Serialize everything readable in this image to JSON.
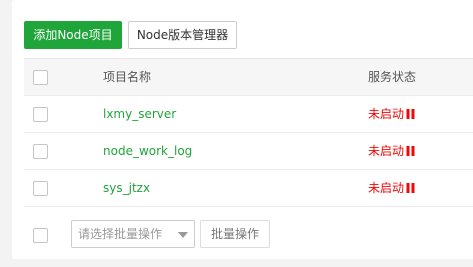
{
  "toolbar": {
    "add_button_label": "添加Node项目",
    "manager_button_label": "Node版本管理器"
  },
  "table": {
    "columns": {
      "name": "项目名称",
      "status": "服务状态"
    },
    "rows": [
      {
        "name": "lxmy_server",
        "status": "未启动"
      },
      {
        "name": "node_work_log",
        "status": "未启动"
      },
      {
        "name": "sys_jtzx",
        "status": "未启动"
      }
    ]
  },
  "footer": {
    "batch_select_placeholder": "请选择批量操作",
    "batch_button_label": "批量操作"
  },
  "colors": {
    "accent": "#20a53a",
    "status_stopped": "#ef0808"
  },
  "icons": {
    "status_stopped": "pause-icon",
    "select_caret": "chevron-down-icon"
  }
}
